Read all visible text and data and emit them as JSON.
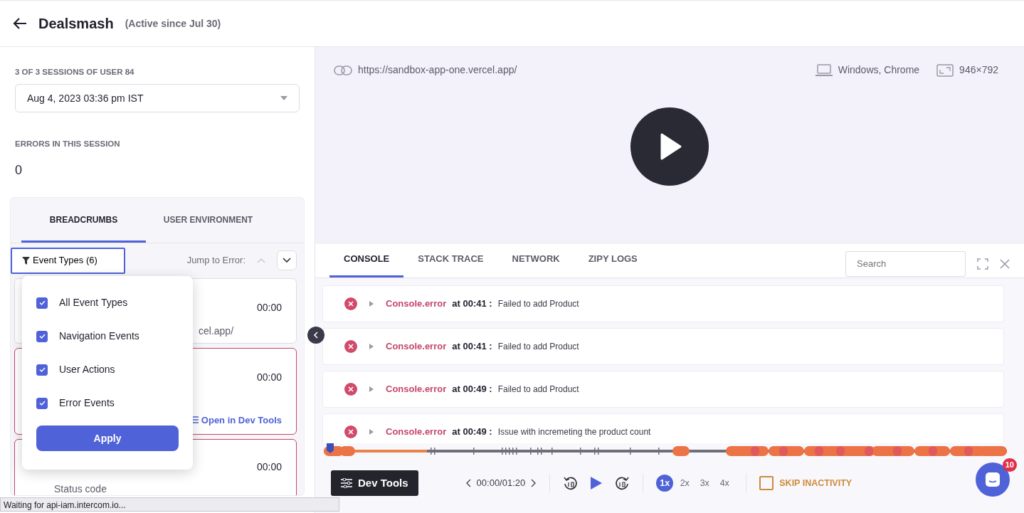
{
  "header": {
    "title": "Dealsmash",
    "subtitle": "(Active since Jul 30)"
  },
  "sessions": {
    "label": "3 OF 3 SESSIONS OF USER 84",
    "value": "Aug 4, 2023 03:36 pm IST"
  },
  "errors": {
    "label": "ERRORS IN THIS SESSION",
    "count": "0"
  },
  "left_tabs": [
    {
      "label": "BREADCRUMBS",
      "selected": true
    },
    {
      "label": "USER ENVIRONMENT",
      "selected": false
    }
  ],
  "filter": {
    "label": "Event Types (6)",
    "jump_label": "Jump to Error:"
  },
  "event_menu": {
    "options": [
      {
        "label": "All Event Types",
        "checked": true
      },
      {
        "label": "Navigation Events",
        "checked": true
      },
      {
        "label": "User Actions",
        "checked": true
      },
      {
        "label": "Error Events",
        "checked": true
      }
    ],
    "apply": "Apply"
  },
  "breadcrumbs": [
    {
      "time": "00:00",
      "detail": "cel.app/",
      "error": false
    },
    {
      "time": "00:00",
      "link": "Open in Dev Tools",
      "error": true
    },
    {
      "time": "00:00",
      "detail": "Status code",
      "error": true
    }
  ],
  "player": {
    "url": "https://sandbox-app-one.vercel.app/",
    "environment": "Windows, Chrome",
    "resolution": "946×792"
  },
  "devtools": {
    "tabs": [
      {
        "label": "CONSOLE",
        "selected": true
      },
      {
        "label": "STACK TRACE",
        "selected": false
      },
      {
        "label": "NETWORK",
        "selected": false
      },
      {
        "label": "ZIPY LOGS",
        "selected": false
      }
    ],
    "search_placeholder": "Search",
    "logs": [
      {
        "source": "Console.error",
        "at": "at",
        "time": "00:41 :",
        "message": "Failed to add Product"
      },
      {
        "source": "Console.error",
        "at": "at",
        "time": "00:41 :",
        "message": "Failed to add Product"
      },
      {
        "source": "Console.error",
        "at": "at",
        "time": "00:49 :",
        "message": "Failed to add Product"
      },
      {
        "source": "Console.error",
        "at": "at",
        "time": "00:49 :",
        "message": "Issue with incremeting the product count"
      }
    ]
  },
  "controls": {
    "devtools_button": "Dev Tools",
    "time": "00:00/01:20",
    "speeds": [
      {
        "label": "1x",
        "selected": true
      },
      {
        "label": "2x",
        "selected": false
      },
      {
        "label": "3x",
        "selected": false
      },
      {
        "label": "4x",
        "selected": false
      }
    ],
    "skip": {
      "label": "SKIP INACTIVITY",
      "checked": false
    }
  },
  "chat": {
    "badge": "10"
  },
  "status_bar": "Waiting for api-iam.intercom.io..."
}
